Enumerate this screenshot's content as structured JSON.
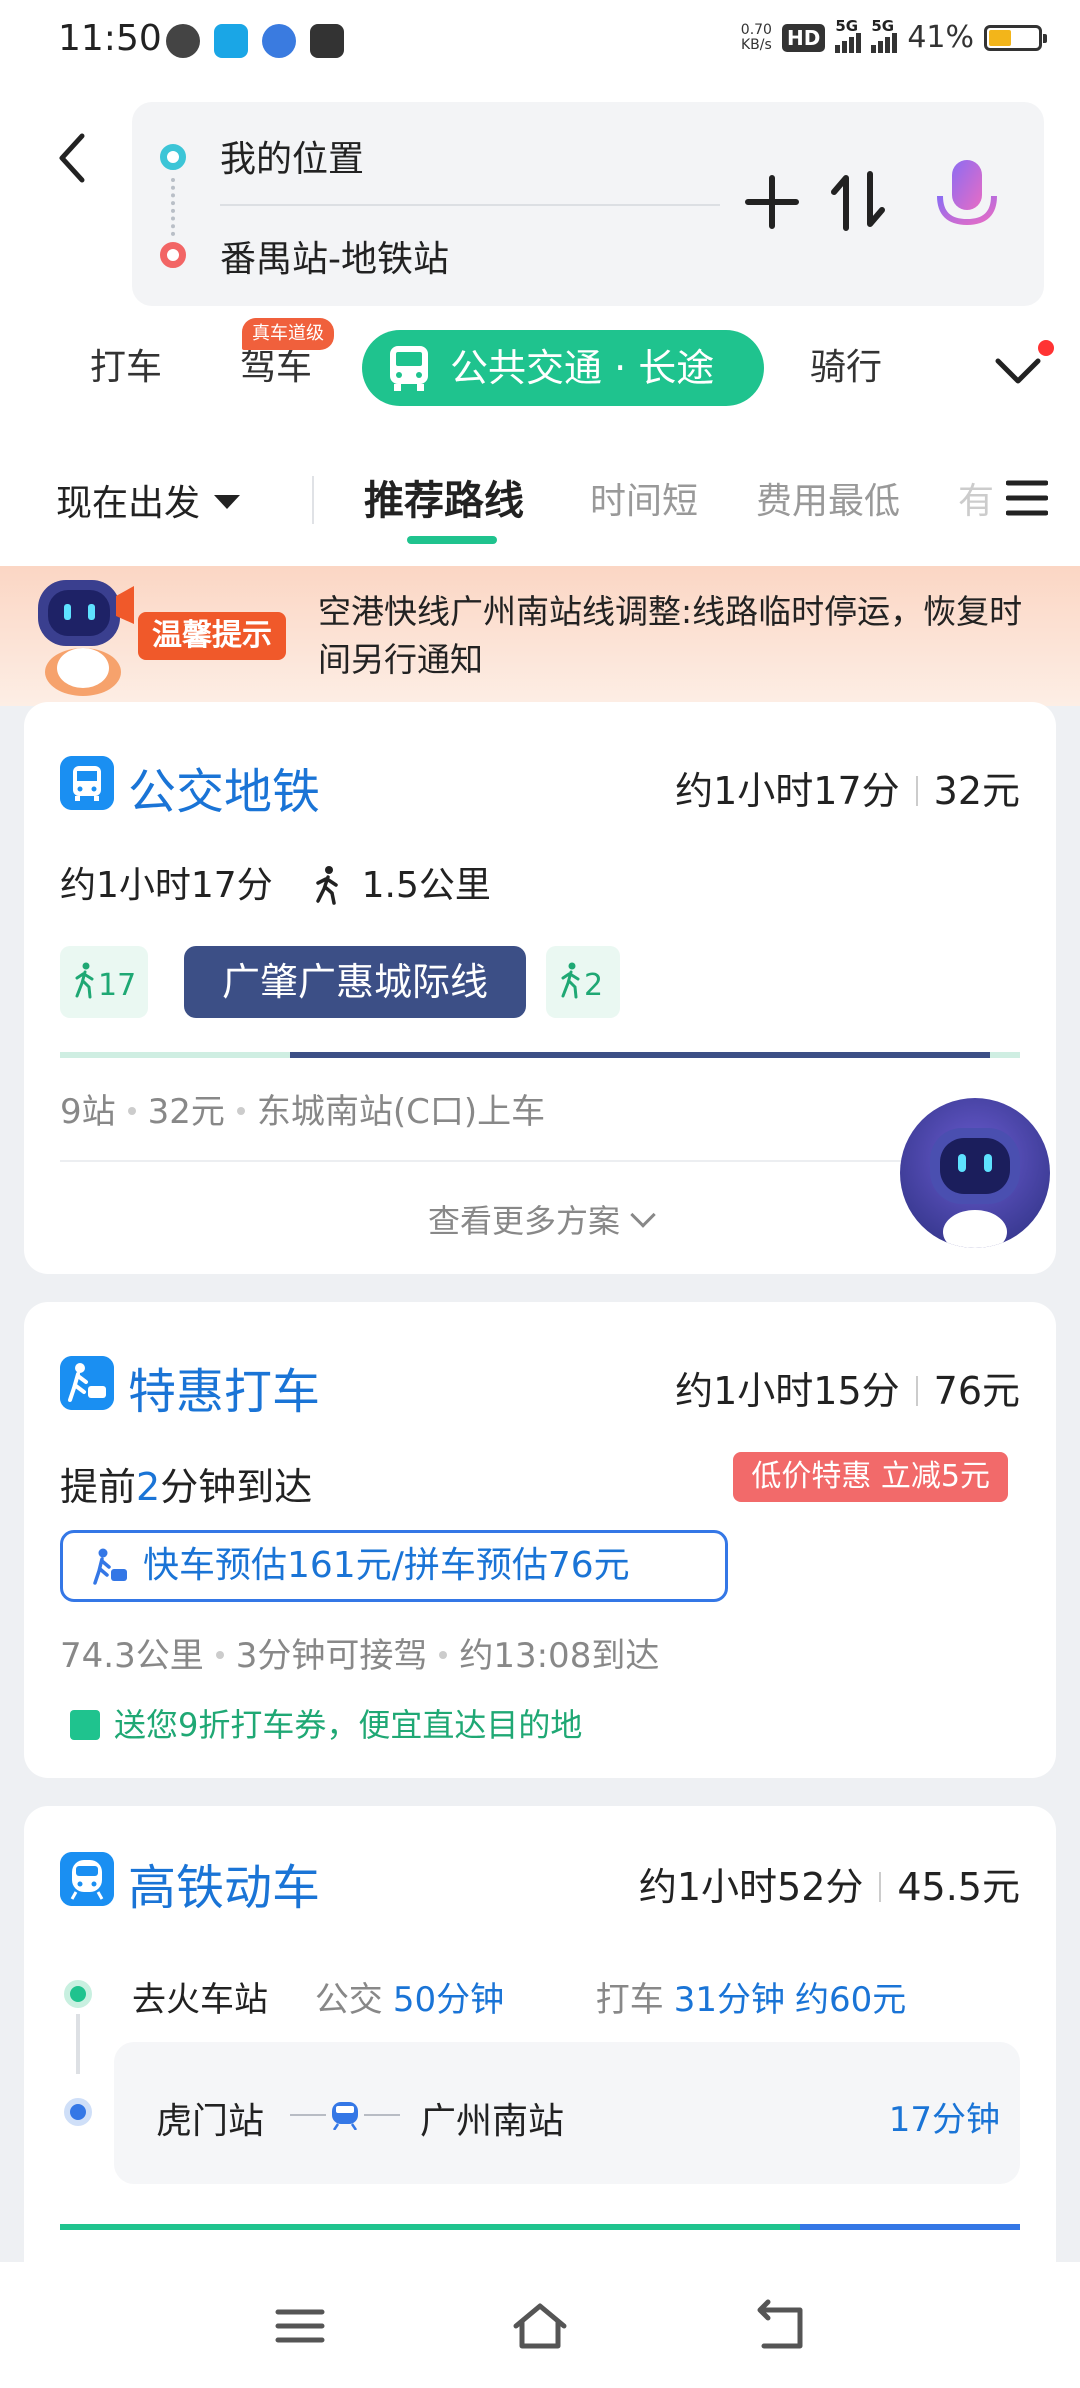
{
  "status_bar": {
    "time": "11:50",
    "net_speed_value": "0.70",
    "net_speed_unit": "KB/s",
    "hd_label": "HD",
    "signal1_label": "5G",
    "signal2_label": "5G",
    "battery_percent": "41%"
  },
  "search": {
    "from": "我的位置",
    "to": "番禺站-地铁站"
  },
  "mode_tabs": {
    "taxi": "打车",
    "drive": "驾车",
    "drive_badge": "真车道级",
    "transit": "公共交通 · 长途",
    "bike": "骑行"
  },
  "sort_bar": {
    "depart": "现在出发",
    "recommend": "推荐路线",
    "shortest": "时间短",
    "cheapest": "费用最低",
    "more": "有"
  },
  "notice": {
    "tag": "温馨提示",
    "text": "空港快线广州南站线调整:线路临时停运，恢复时间另行通知"
  },
  "transit_card": {
    "title": "公交地铁",
    "duration": "约1小时17分",
    "price": "32元",
    "detail_duration": "约1小时17分",
    "walk_distance": "1.5公里",
    "walk1_minutes": "17",
    "line_name": "广肇广惠城际线",
    "walk2_minutes": "2",
    "stops": "9站",
    "fare": "32元",
    "board_at": "东城南站(C口)上车",
    "more_plans": "查看更多方案"
  },
  "taxi_card": {
    "title": "特惠打车",
    "duration": "约1小时15分",
    "price": "76元",
    "eta_prefix": "提前",
    "eta_num": "2",
    "eta_suffix": "分钟到达",
    "discount": "低价特惠 立减5元",
    "estimate": "快车预估161元/拼车预估76元",
    "distance": "74.3公里",
    "pickup": "3分钟可接驾",
    "arrive": "约13:08到达",
    "promo": "送您9折打车券，便宜直达目的地"
  },
  "rail_card": {
    "title": "高铁动车",
    "duration": "约1小时52分",
    "price": "45.5元",
    "to_station": "去火车站",
    "bus_label": "公交",
    "bus_time": "50分钟",
    "taxi_label": "打车",
    "taxi_time": "31分钟",
    "taxi_price": "约60元",
    "from_station": "虎门站",
    "dest_station": "广州南站",
    "ride_time": "17分钟"
  },
  "colors": {
    "brand_green": "#1fc38e",
    "brand_blue": "#1a74d6",
    "line_navy": "#3c4f86",
    "alert_orange": "#f0592a",
    "discount_red": "#f26a6a"
  },
  "icons": [
    "back-arrow-icon",
    "add-icon",
    "swap-icon",
    "mic-icon",
    "bus-icon",
    "chevron-down-icon",
    "list-icon",
    "robot-icon",
    "walk-icon",
    "taxi-icon",
    "train-icon",
    "thumbs-up-icon",
    "menu-icon",
    "home-icon",
    "back-icon"
  ]
}
